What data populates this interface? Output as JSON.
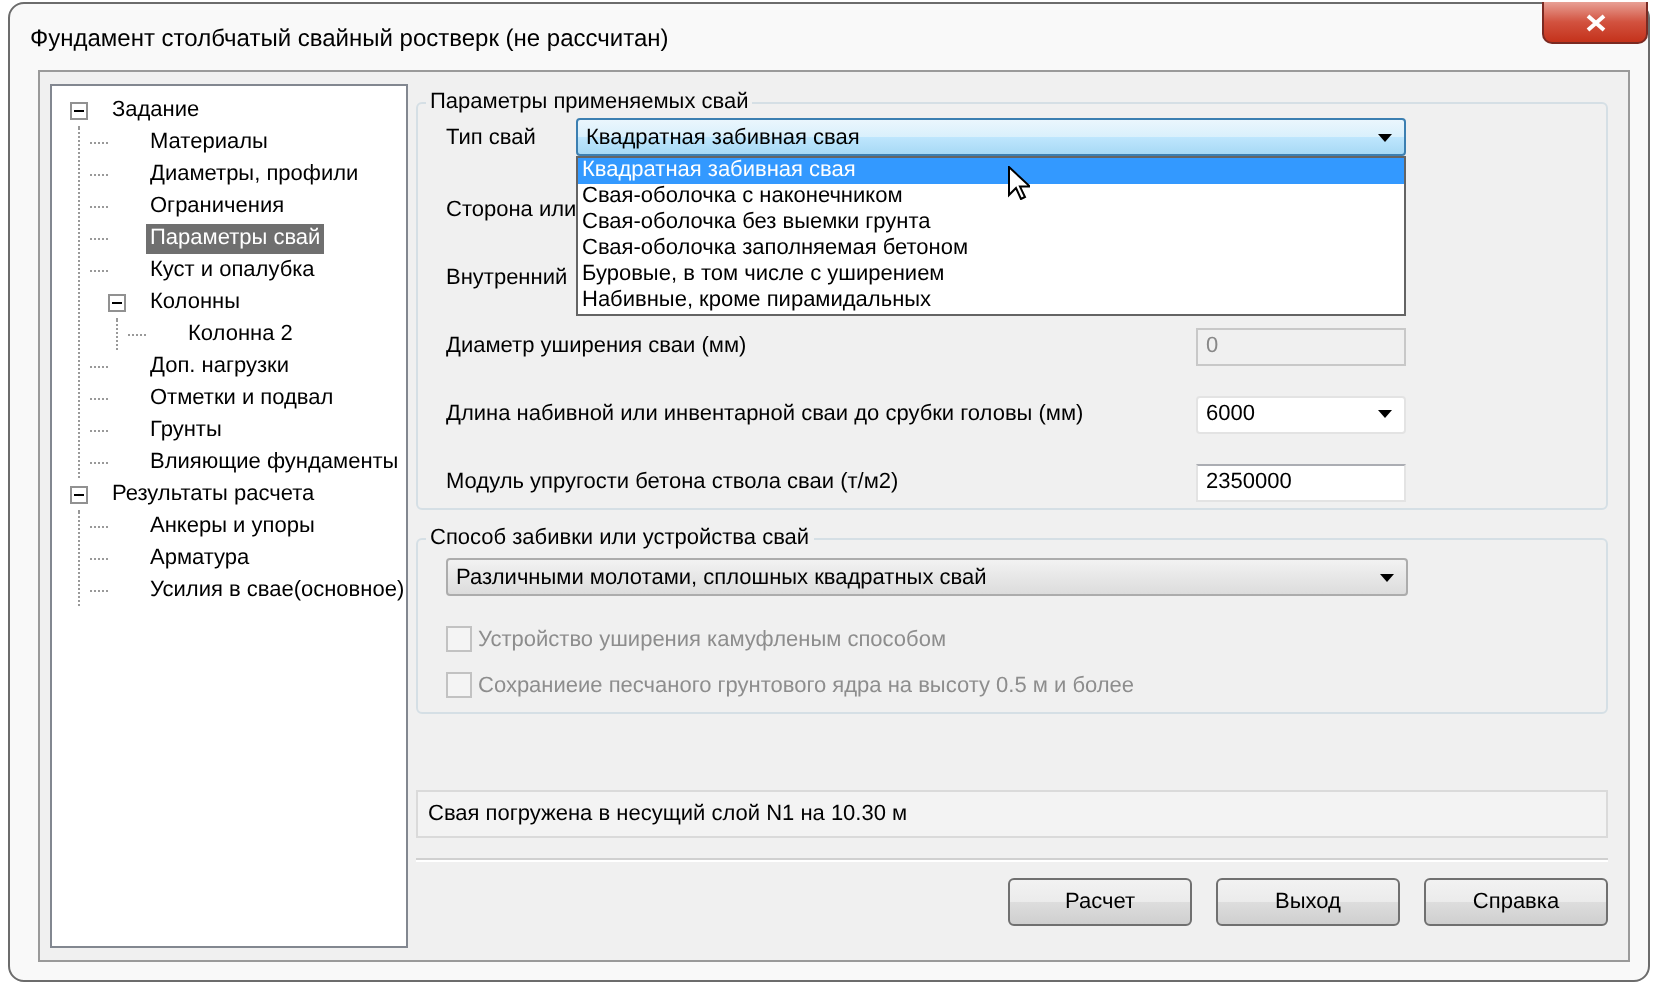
{
  "window": {
    "title": "Фундамент столбчатый свайный ростверк (не рассчитан)"
  },
  "tree": [
    {
      "label": "Задание",
      "selected": false,
      "expanded": true,
      "children": [
        {
          "label": "Материалы",
          "selected": false
        },
        {
          "label": "Диаметры, профили",
          "selected": false
        },
        {
          "label": "Ограничения",
          "selected": false
        },
        {
          "label": "Параметры свай",
          "selected": true
        },
        {
          "label": "Куст и опалубка",
          "selected": false
        },
        {
          "label": "Колонны",
          "selected": false,
          "expanded": true,
          "children": [
            {
              "label": "Колонна 2",
              "selected": false
            }
          ]
        },
        {
          "label": "Доп. нагрузки",
          "selected": false
        },
        {
          "label": "Отметки и подвал",
          "selected": false
        },
        {
          "label": "Грунты",
          "selected": false
        },
        {
          "label": "Влияющие фундаменты",
          "selected": false
        }
      ]
    },
    {
      "label": "Результаты расчета",
      "selected": false,
      "expanded": true,
      "children": [
        {
          "label": "Анкеры и упоры",
          "selected": false
        },
        {
          "label": "Арматура",
          "selected": false
        },
        {
          "label": "Усилия в свае(основное)",
          "selected": false
        }
      ]
    }
  ],
  "pile_params": {
    "legend": "Параметры применяемых свай",
    "fields": [
      {
        "kind": "combo",
        "label": "Тип свай",
        "value": "Квадратная забивная свая",
        "focused": true,
        "disabled": false,
        "options": [
          {
            "label": "Квадратная забивная свая",
            "selected": true
          },
          {
            "label": "Свая-оболочка с наконечником",
            "selected": false
          },
          {
            "label": "Свая-оболочка без выемки грунта",
            "selected": false
          },
          {
            "label": "Свая-оболочка заполняемая бетоном",
            "selected": false
          },
          {
            "label": "Буровые, в том числе с уширением",
            "selected": false
          },
          {
            "label": "Набивные, кроме пирамидальных",
            "selected": false
          }
        ]
      },
      {
        "kind": "label",
        "label": "Сторона или"
      },
      {
        "kind": "label",
        "label": "Внутренний"
      },
      {
        "kind": "input",
        "label": "Диаметр уширения сваи (мм)",
        "value": "0",
        "disabled": true
      },
      {
        "kind": "combo",
        "label": "Длина набивной или инвентарной сваи до срубки головы (мм)",
        "value": "6000",
        "focused": false,
        "disabled": false
      },
      {
        "kind": "input",
        "label": "Модуль упругости бетона ствола сваи (т/м2)",
        "value": "2350000",
        "disabled": false
      }
    ]
  },
  "driving": {
    "legend": "Способ забивки или устройства свай",
    "method": {
      "value": "Различными молотами, сплошных квадратных свай",
      "focused": false,
      "disabled": false
    },
    "checkboxes": [
      {
        "label": "Устройство уширения камуфленым способом",
        "checked": false,
        "disabled": true
      },
      {
        "label": "Сохраниеие песчаного грунтового ядра на высоту 0.5 м и более",
        "checked": false,
        "disabled": true
      }
    ]
  },
  "status": "Свая погружена в несущий слой N1 на 10.30 м",
  "buttons": [
    "Расчет",
    "Выход",
    "Справка"
  ]
}
